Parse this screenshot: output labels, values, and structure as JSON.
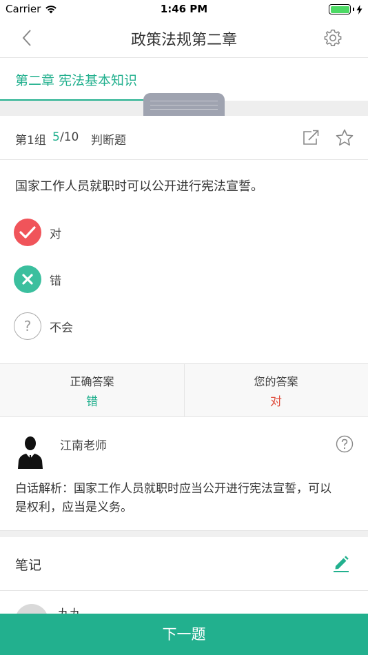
{
  "status_bar": {
    "carrier": "Carrier",
    "time": "1:46 PM",
    "wifi_icon": "wifi-icon",
    "battery_icon": "battery-icon",
    "charging_icon": "bolt-icon"
  },
  "nav": {
    "title": "政策法规第二章",
    "back_icon": "chevron-left-icon",
    "settings_icon": "gear-icon"
  },
  "chapter_tab": {
    "label": "第二章 宪法基本知识"
  },
  "question_header": {
    "group": "第1组",
    "current": "5",
    "total": "/10",
    "type": "判断题",
    "share_icon": "share-icon",
    "favorite_icon": "star-icon"
  },
  "question": {
    "text": "国家工作人员就职时可以公开进行宪法宣誓。",
    "options": [
      {
        "label": "对",
        "icon": "check-circle-icon",
        "color": "#f0545a"
      },
      {
        "label": "错",
        "icon": "x-circle-icon",
        "color": "#3bbf9e"
      },
      {
        "label": "不会",
        "icon": "question-circle-icon",
        "color": "#aaaaaa"
      }
    ]
  },
  "answers": {
    "correct_label": "正确答案",
    "correct_value": "错",
    "yours_label": "您的答案",
    "yours_value": "对"
  },
  "analysis": {
    "teacher": "江南老师",
    "text": "白话解析：国家工作人员就职时应当公开进行宪法宣誓，可以是权利，应当是义务。"
  },
  "notes": {
    "title": "笔记",
    "edit_icon": "pencil-icon"
  },
  "comment": {
    "name": "九九"
  },
  "next_button": {
    "label": "下一题"
  },
  "colors": {
    "accent": "#22b08e",
    "correct": "#22b08e",
    "wrong": "#e04f3f"
  }
}
